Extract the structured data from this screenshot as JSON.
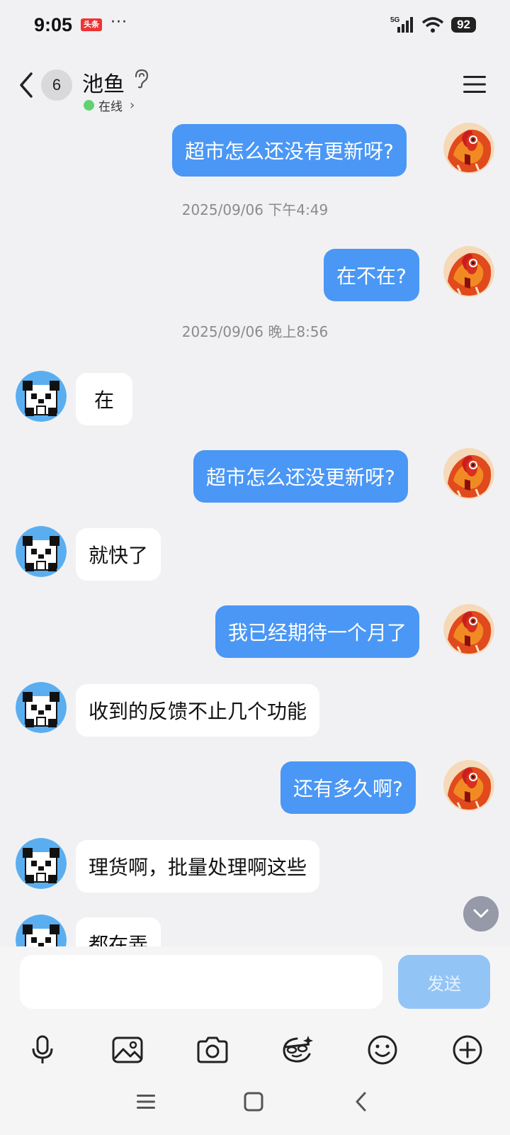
{
  "status_bar": {
    "time": "9:05",
    "app_badge": "头条",
    "more": "···",
    "network": "5G",
    "battery": "92"
  },
  "header": {
    "unread_count": "6",
    "contact_name": "池鱼",
    "status": "在线"
  },
  "timestamps": [
    "2025/09/06 下午4:49",
    "2025/09/06 晚上8:56"
  ],
  "messages": [
    {
      "dir": "out",
      "text": "超市怎么还没有更新呀?"
    },
    {
      "dir": "out",
      "text": "在不在?"
    },
    {
      "dir": "in",
      "text": "在"
    },
    {
      "dir": "out",
      "text": "超市怎么还没更新呀?"
    },
    {
      "dir": "in",
      "text": "就快了"
    },
    {
      "dir": "out",
      "text": "我已经期待一个月了"
    },
    {
      "dir": "in",
      "text": "收到的反馈不止几个功能"
    },
    {
      "dir": "out",
      "text": "还有多久啊?"
    },
    {
      "dir": "in",
      "text": "理货啊，批量处理啊这些"
    },
    {
      "dir": "in",
      "text": "都在弄"
    }
  ],
  "input": {
    "placeholder": "",
    "send_label": "发送"
  },
  "toolbar": [
    "microphone-icon",
    "image-icon",
    "camera-icon",
    "sticker-icon",
    "emoji-icon",
    "plus-icon"
  ],
  "colors": {
    "outgoing_bubble": "#4a97f5",
    "incoming_bubble": "#ffffff",
    "send_button": "#93c4f6",
    "online": "#5fd36f"
  }
}
